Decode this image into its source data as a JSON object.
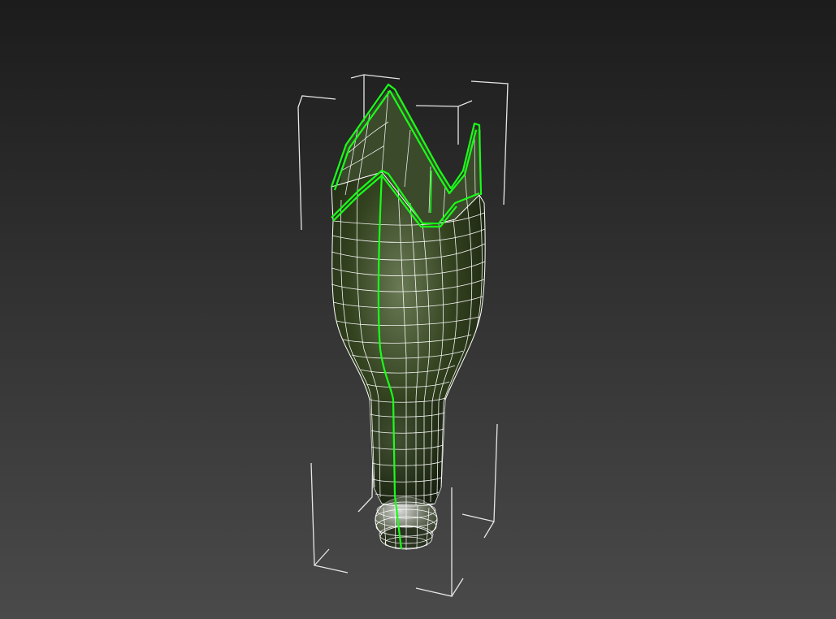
{
  "viewport": {
    "background_top": "#1c1c1c",
    "background_bottom": "#4a4a4a"
  },
  "object": {
    "type": "broken-bottle",
    "base_color": "#2f3d22",
    "wire_color": "#ffffff",
    "selection_color": "#19ff19",
    "bbox_color": "#e6e6e6",
    "selected": true
  }
}
